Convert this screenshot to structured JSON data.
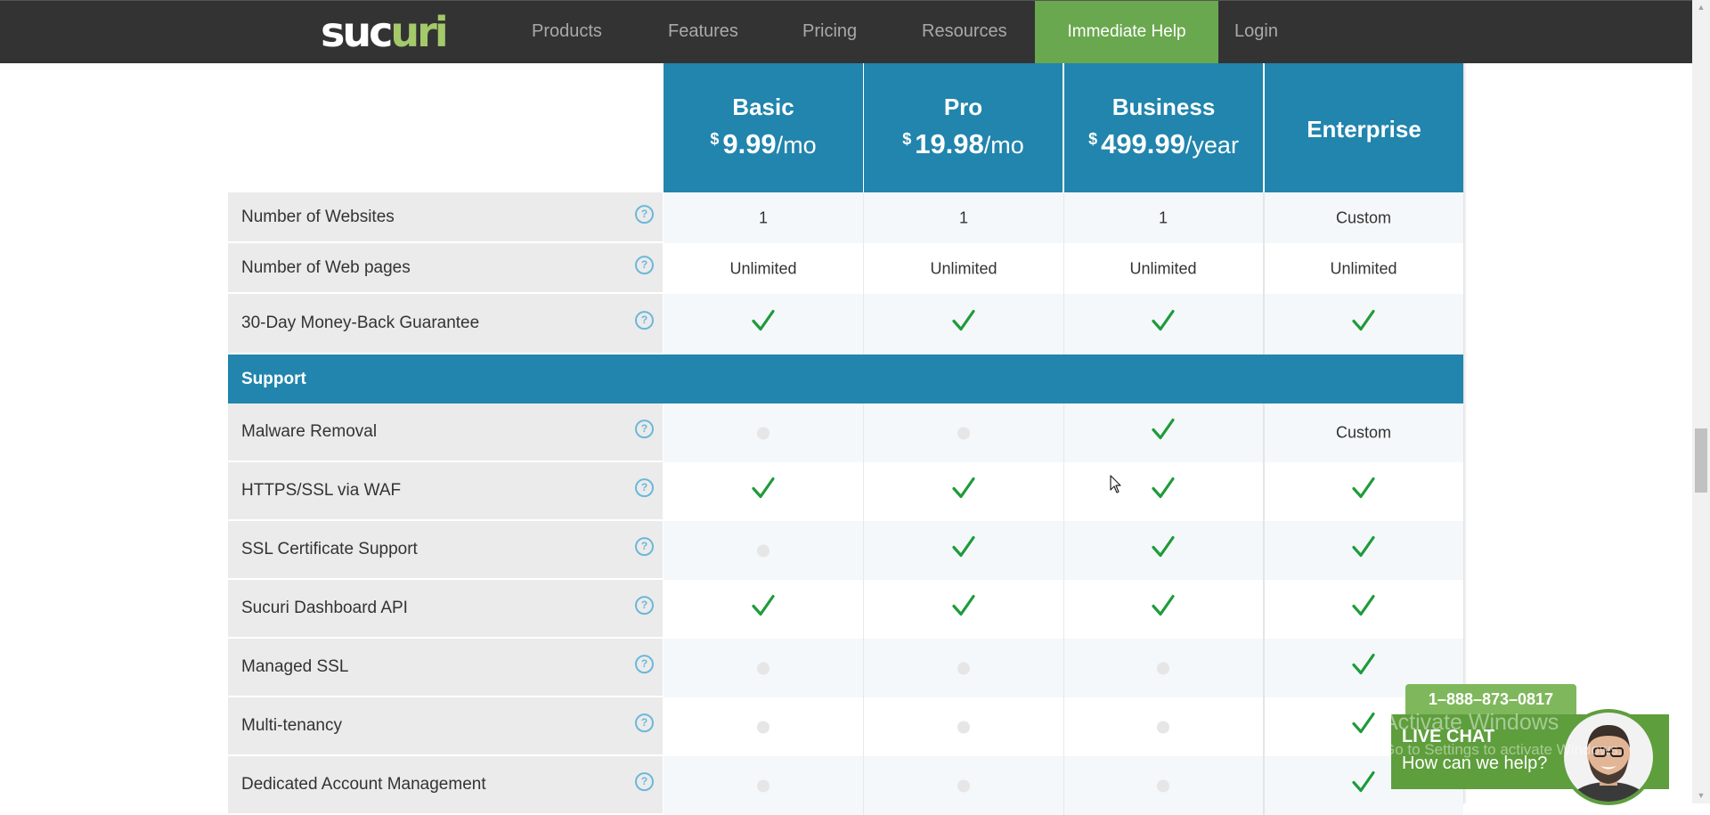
{
  "nav": {
    "logo": {
      "left": "suc",
      "right": "uri"
    },
    "items": [
      "Products",
      "Features",
      "Pricing",
      "Resources"
    ],
    "help": "Immediate Help",
    "login": "Login"
  },
  "plans": [
    {
      "name": "Basic",
      "currency": "$",
      "price": "9.99",
      "period": "/mo"
    },
    {
      "name": "Pro",
      "currency": "$",
      "price": "19.98",
      "period": "/mo"
    },
    {
      "name": "Business",
      "currency": "$",
      "price": "499.99",
      "period": "/year"
    },
    {
      "name": "Enterprise"
    }
  ],
  "rows": [
    {
      "label": "Number of Websites",
      "values": [
        "1",
        "1",
        "1",
        "Custom"
      ]
    },
    {
      "label": "Number of Web pages",
      "values": [
        "Unlimited",
        "Unlimited",
        "Unlimited",
        "Unlimited"
      ]
    },
    {
      "label": "30-Day Money-Back Guarantee",
      "values": [
        "check",
        "check",
        "check",
        "check"
      ]
    }
  ],
  "section": {
    "title": "Support"
  },
  "support_rows": [
    {
      "label": "Malware Removal",
      "values": [
        "dot",
        "dot",
        "check",
        "Custom"
      ]
    },
    {
      "label": "HTTPS/SSL via WAF",
      "values": [
        "check",
        "check",
        "check",
        "check"
      ]
    },
    {
      "label": "SSL Certificate Support",
      "values": [
        "dot",
        "check",
        "check",
        "check"
      ]
    },
    {
      "label": "Sucuri Dashboard API",
      "values": [
        "check",
        "check",
        "check",
        "check"
      ]
    },
    {
      "label": "Managed SSL",
      "values": [
        "dot",
        "dot",
        "dot",
        "check"
      ]
    },
    {
      "label": "Multi-tenancy",
      "values": [
        "dot",
        "dot",
        "dot",
        "check"
      ]
    },
    {
      "label": "Dedicated Account Management",
      "values": [
        "dot",
        "dot",
        "dot",
        "check"
      ]
    }
  ],
  "help_glyph": "?",
  "chat": {
    "phone": "1–888–873–0817",
    "title": "LIVE CHAT",
    "subtitle": "How can we help?"
  },
  "watermark": {
    "title": "Activate Windows",
    "subtitle": "Go to Settings to activate Windows."
  },
  "colors": {
    "nav_bg": "#333333",
    "accent_blue": "#2185ad",
    "help_green": "#6aa84f",
    "check_green": "#1e9b3a",
    "chat_green": "#5e9e3c"
  },
  "icons": {
    "check": "check-icon",
    "unavailable": "dot-icon",
    "help": "help-circle-icon",
    "cursor": "mouse-cursor-icon"
  }
}
